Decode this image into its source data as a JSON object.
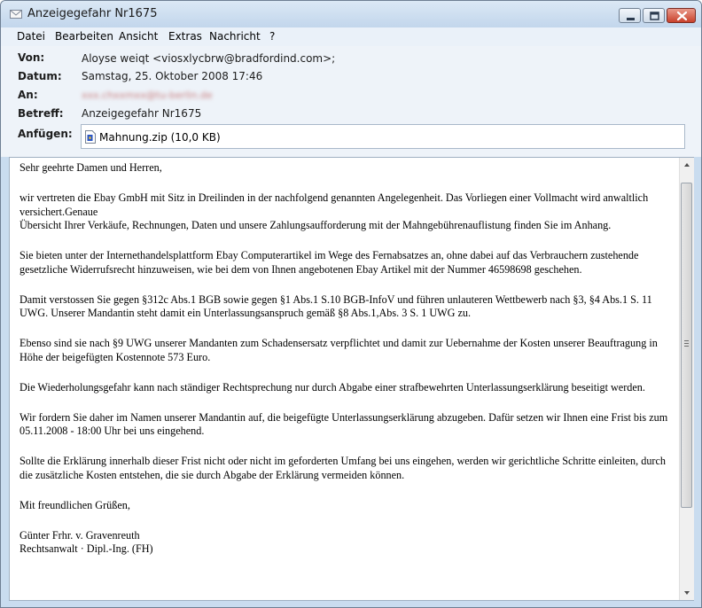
{
  "window": {
    "title": "Anzeigegefahr Nr1675"
  },
  "menu": [
    "Datei",
    "Bearbeiten",
    "Ansicht",
    "Extras",
    "Nachricht",
    "?"
  ],
  "header": {
    "from_label": "Von:",
    "from_value": "Aloyse  weiqt  <viosxlycbrw@bradfordind.com>;",
    "date_label": "Datum:",
    "date_value": "Samstag, 25. Oktober 2008 17:46",
    "to_label": "An:",
    "to_value": "xxx.chxxmxx@tu-berlin.de",
    "subject_label": "Betreff:",
    "subject_value": "Anzeigegefahr Nr1675",
    "attach_label": "Anfügen:",
    "attach_value": "Mahnung.zip (10,0 KB)"
  },
  "body": {
    "greeting": "Sehr geehrte Damen und Herren,",
    "p1_line1": "wir vertreten die Ebay GmbH mit Sitz in Dreilinden in der nachfolgend genannten Angelegenheit. Das Vorliegen einer Vollmacht wird anwaltlich versichert.Genaue",
    "p1_line2": "Übersicht Ihrer Verkäufe, Rechnungen, Daten und unsere Zahlungsaufforderung mit der Mahngebührenauflistung finden Sie im Anhang.",
    "p2": "Sie bieten unter der Internethandelsplattform Ebay Computerartikel im Wege des Fernabsatzes an, ohne dabei auf das Verbrauchern zustehende gesetzliche Widerrufsrecht hinzuweisen, wie bei dem von Ihnen angebotenen Ebay Artikel mit der Nummer 46598698 geschehen.",
    "p3": "Damit verstossen Sie gegen §312c Abs.1 BGB sowie gegen §1 Abs.1 S.10 BGB-InfoV und führen unlauteren Wettbewerb nach §3, §4 Abs.1 S. 11 UWG. Unserer Mandantin steht damit ein Unterlassungsanspruch gemäß §8 Abs.1,Abs. 3 S. 1 UWG zu.",
    "p4": "Ebenso sind sie nach §9 UWG unserer Mandanten zum Schadensersatz verpflichtet und damit zur Uebernahme der Kosten unserer Beauftragung in Höhe der beigefügten Kostennote 573 Euro.",
    "p5": "Die Wiederholungsgefahr kann nach ständiger Rechtsprechung nur durch Abgabe einer strafbewehrten Unterlassungserklärung beseitigt werden.",
    "p6": "Wir fordern Sie daher im Namen unserer Mandantin auf, die beigefügte Unterlassungserklärung abzugeben. Dafür setzen wir Ihnen eine Frist bis zum 05.11.2008 - 18:00 Uhr bei uns eingehend.",
    "p7": "Sollte die Erklärung innerhalb dieser Frist nicht oder nicht im geforderten Umfang bei uns eingehen, werden wir gerichtliche Schritte einleiten, durch die zusätzliche Kosten entstehen, die sie durch Abgabe der Erklärung vermeiden können.",
    "closing": "Mit freundlichen Grüßen,",
    "sig_name": "Günter Frhr. v. Gravenreuth",
    "sig_title": "Rechtsanwalt · Dipl.-Ing. (FH)"
  },
  "icons": {
    "title": "envelope-icon",
    "attachment": "zip-file-icon",
    "minimize": "minimize-icon",
    "maximize": "maximize-icon",
    "close": "close-icon"
  }
}
